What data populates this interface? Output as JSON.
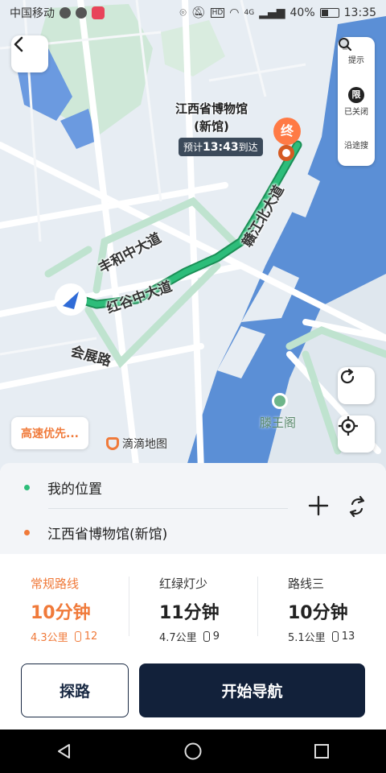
{
  "status_bar": {
    "carrier": "中国移动",
    "battery": "40%",
    "time": "13:35",
    "network": "4G",
    "hd": "HD"
  },
  "map": {
    "destination": {
      "name_line1": "江西省博物馆",
      "name_line2": "(新馆)",
      "marker_label": "终"
    },
    "eta": {
      "prefix": "预计",
      "time": "13:43",
      "suffix": "到达"
    },
    "roads": [
      "赣江北大道",
      "丰和中大道",
      "红谷中大道",
      "会展路"
    ],
    "poi": "滕王阁",
    "brand": "滴滴地图",
    "preference": "高速优先...",
    "tools": [
      {
        "icon": "hint-icon",
        "label": "提示"
      },
      {
        "icon": "limit-icon",
        "icon_text": "限",
        "label": "已关闭"
      },
      {
        "icon": "search-icon",
        "label": "沿途搜"
      }
    ]
  },
  "waypoints": {
    "origin": "我的位置",
    "destination": "江西省博物馆(新馆)"
  },
  "routes": [
    {
      "name": "常规路线",
      "time": "10分钟",
      "distance": "4.3公里",
      "lights": "12",
      "active": true
    },
    {
      "name": "红绿灯少",
      "time": "11分钟",
      "distance": "4.7公里",
      "lights": "9",
      "active": false
    },
    {
      "name": "路线三",
      "time": "10分钟",
      "distance": "5.1公里",
      "lights": "13",
      "active": false
    }
  ],
  "actions": {
    "explore": "探路",
    "start": "开始导航"
  },
  "colors": {
    "accent": "#f07a3a",
    "primary_dark": "#12213a",
    "route_green": "#2dbd7a",
    "water": "#5b8fd6"
  }
}
